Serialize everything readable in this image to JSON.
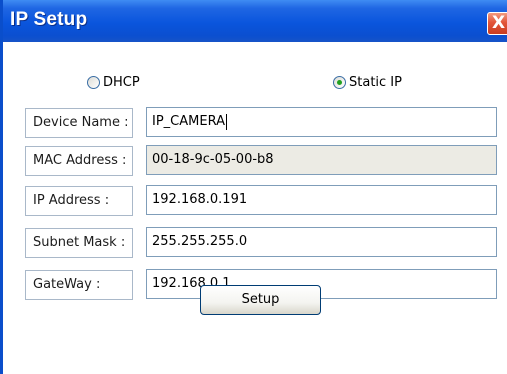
{
  "window": {
    "title": "IP Setup",
    "close_glyph": "X"
  },
  "mode": {
    "options": [
      {
        "label": "DHCP",
        "selected": false
      },
      {
        "label": "Static IP",
        "selected": true
      }
    ]
  },
  "fields": [
    {
      "label": "Device Name :",
      "value": "IP_CAMERA",
      "editable": true,
      "focused": true
    },
    {
      "label": "MAC Address :",
      "value": "00-18-9c-05-00-b8",
      "editable": false
    },
    {
      "label": "IP Address :",
      "value": "192.168.0.191",
      "editable": true
    },
    {
      "label": "Subnet Mask :",
      "value": "255.255.255.0",
      "editable": true
    },
    {
      "label": "GateWay :",
      "value": "192.168.0.1",
      "editable": true
    }
  ],
  "actions": {
    "setup_label": "Setup"
  },
  "colors": {
    "titlebar": "#0a55dd",
    "close_button": "#e2553a",
    "radio_selected_dot": "#21a121",
    "readonly_field": "#ecebe4"
  }
}
